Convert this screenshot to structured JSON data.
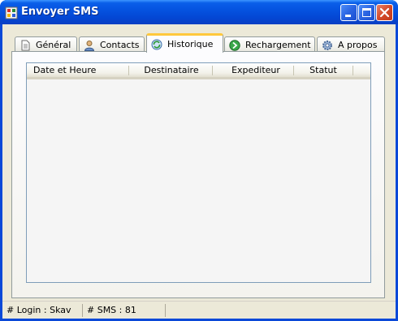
{
  "window": {
    "title": "Envoyer SMS"
  },
  "tabs": [
    {
      "label": "Général",
      "icon": "document-icon"
    },
    {
      "label": "Contacts",
      "icon": "user-icon"
    },
    {
      "label": "Historique",
      "icon": "refresh-icon",
      "active": true
    },
    {
      "label": "Rechargement",
      "icon": "recharge-icon"
    },
    {
      "label": "A propos",
      "icon": "gear-icon"
    }
  ],
  "history": {
    "columns": [
      "Date et Heure",
      "Destinataire",
      "Expediteur",
      "Statut"
    ],
    "rows": []
  },
  "statusbar": {
    "login": "# Login : Skav",
    "sms": "# SMS : 81"
  },
  "colors": {
    "titlebar": "#0553e0",
    "face": "#ece9d8",
    "active_tab_accent": "#ffc83c"
  }
}
